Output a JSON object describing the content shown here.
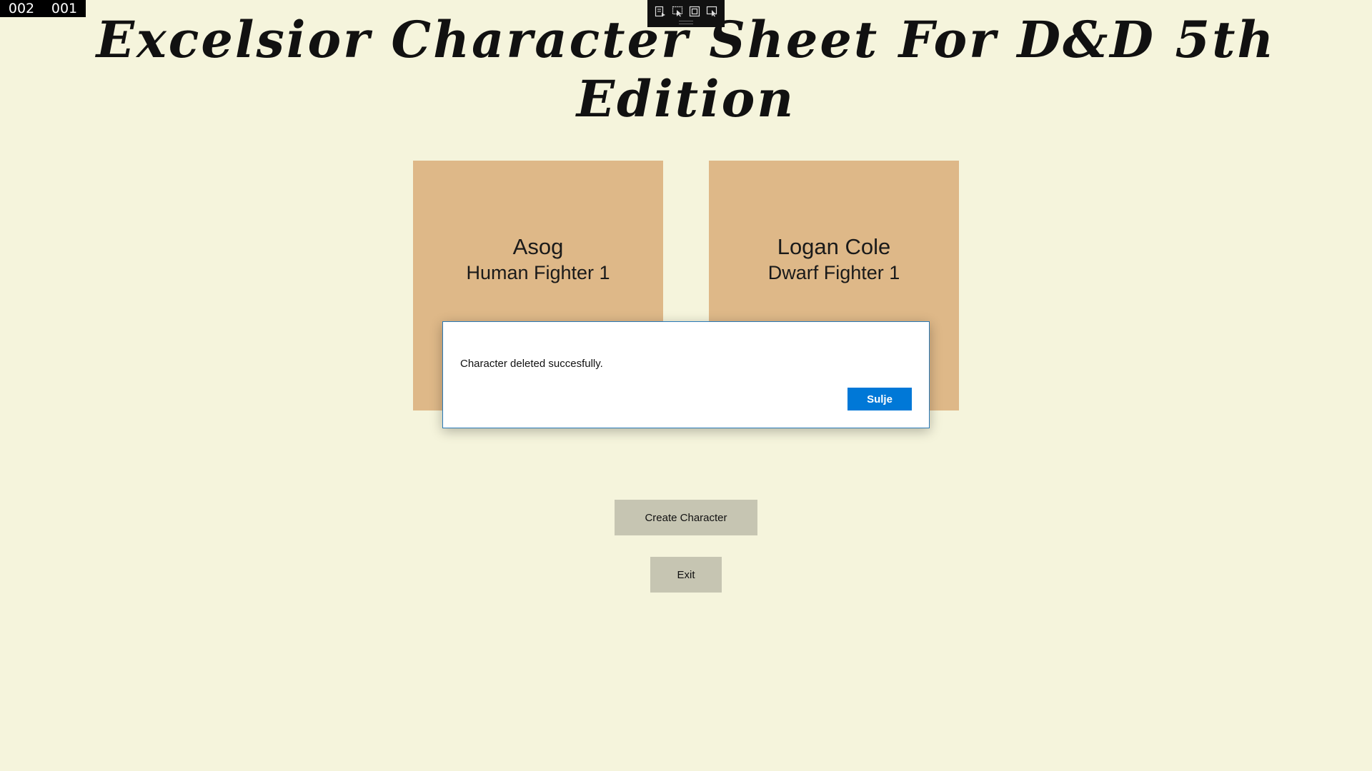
{
  "debug_counter": {
    "value_left": "002",
    "value_right": "001"
  },
  "debug_toolbar": {
    "icons": [
      "live-visual-tree-icon",
      "select-element-icon",
      "display-layout-adorners-icon",
      "track-focus-icon"
    ]
  },
  "app": {
    "title": "Excelsior Character Sheet For D&D 5th Edition"
  },
  "characters": [
    {
      "name": "Asog",
      "description": "Human Fighter 1"
    },
    {
      "name": "Logan Cole",
      "description": "Dwarf Fighter 1"
    }
  ],
  "actions": {
    "create_label": "Create Character",
    "exit_label": "Exit"
  },
  "dialog": {
    "message": "Character deleted succesfully.",
    "close_label": "Sulje"
  },
  "colors": {
    "background": "#F5F4DC",
    "card": "#DEB888",
    "button": "#C6C5B2",
    "accent": "#0078D7"
  }
}
